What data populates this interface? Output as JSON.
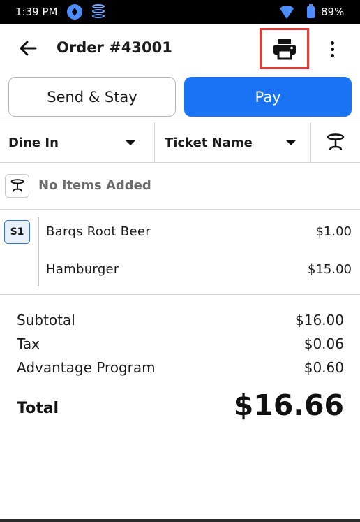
{
  "status_bar": {
    "time": "1:39 PM",
    "battery": "89%",
    "icons": [
      "app-a-icon",
      "database-icon",
      "wifi-icon",
      "battery-icon"
    ]
  },
  "header": {
    "title": "Order #43001",
    "back_icon": "arrow-left-icon",
    "print_icon": "printer-icon",
    "more_icon": "more-vertical-icon"
  },
  "actions": {
    "send_stay_label": "Send & Stay",
    "pay_label": "Pay",
    "pay_color": "#1a73f5"
  },
  "selectors": {
    "dine_option": "Dine In",
    "ticket_name": "Ticket Name",
    "table_icon": "table-icon"
  },
  "empty_table": {
    "text": "No Items Added"
  },
  "seat": {
    "label": "S1",
    "items": [
      {
        "name": "Barqs Root Beer",
        "price": "$1.00"
      },
      {
        "name": "Hamburger",
        "price": "$15.00"
      }
    ]
  },
  "totals": {
    "subtotal_label": "Subtotal",
    "subtotal": "$16.00",
    "tax_label": "Tax",
    "tax": "$0.06",
    "program_label": "Advantage Program",
    "program": "$0.60",
    "total_label": "Total",
    "total": "$16.66"
  },
  "highlight_color": "#e53935"
}
